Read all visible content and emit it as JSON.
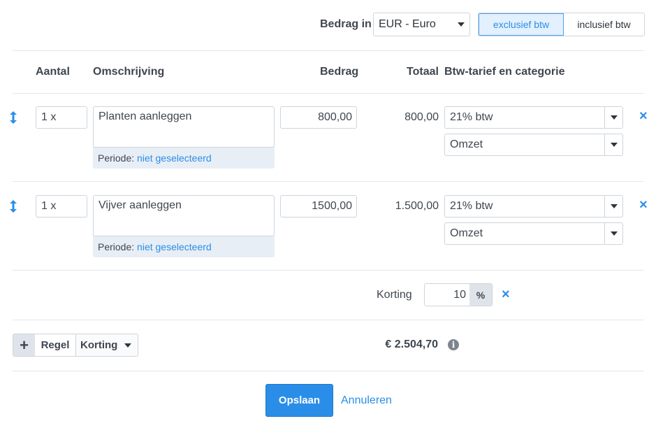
{
  "currency": {
    "label": "Bedrag in",
    "selected": "EUR - Euro",
    "tax_mode": {
      "exclusive": "exclusief btw",
      "inclusive": "inclusief btw",
      "active": "exclusive"
    }
  },
  "headers": {
    "quantity": "Aantal",
    "description": "Omschrijving",
    "amount": "Bedrag",
    "total": "Totaal",
    "vat": "Btw-tarief en categorie"
  },
  "rows": [
    {
      "quantity": "1 x",
      "description": "Planten aanleggen",
      "period_label": "Periode:",
      "period_value": "niet geselecteerd",
      "amount": "800,00",
      "total": "800,00",
      "vat_rate": "21% btw",
      "category": "Omzet"
    },
    {
      "quantity": "1 x",
      "description": "Vijver aanleggen",
      "period_label": "Periode:",
      "period_value": "niet geselecteerd",
      "amount": "1500,00",
      "total": "1.500,00",
      "vat_rate": "21% btw",
      "category": "Omzet"
    }
  ],
  "discount": {
    "label": "Korting",
    "value": "10",
    "unit": "%"
  },
  "add": {
    "plus": "+",
    "line": "Regel",
    "discount": "Korting"
  },
  "summary": {
    "total": "€ 2.504,70",
    "info": "i"
  },
  "actions": {
    "save": "Opslaan",
    "cancel": "Annuleren"
  },
  "icons": {
    "remove": "×",
    "drag": "drag-handle-icon"
  },
  "colors": {
    "accent": "#2a8ee8",
    "text": "#3f4650",
    "border": "#cfd4da"
  }
}
